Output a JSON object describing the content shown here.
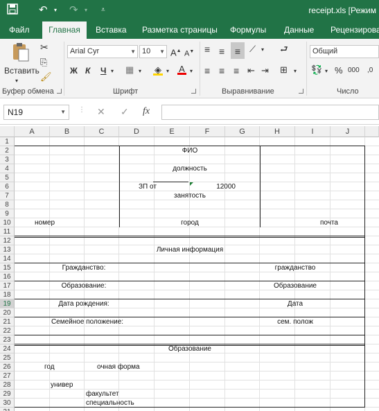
{
  "titlebar": {
    "title": "receipt.xls  [Режим"
  },
  "tabs": [
    {
      "label": "Файл",
      "active": false
    },
    {
      "label": "Главная",
      "active": true
    },
    {
      "label": "Вставка",
      "active": false
    },
    {
      "label": "Разметка страницы",
      "active": false
    },
    {
      "label": "Формулы",
      "active": false
    },
    {
      "label": "Данные",
      "active": false
    },
    {
      "label": "Рецензирова",
      "active": false
    }
  ],
  "ribbon": {
    "paste_label": "Вставить",
    "font_name": "Arial Cyr",
    "font_size": "10",
    "bold": "Ж",
    "italic": "К",
    "underline": "Ч",
    "number_format": "Общий",
    "percent": "%",
    "thousands": "000",
    "groups": {
      "clipboard": "Буфер обмена",
      "font": "Шрифт",
      "alignment": "Выравнивание",
      "number": "Число"
    }
  },
  "formula_bar": {
    "name_box": "N19",
    "fx": "fx",
    "value": ""
  },
  "columns": [
    "A",
    "B",
    "C",
    "D",
    "E",
    "F",
    "G",
    "H",
    "I",
    "J"
  ],
  "rows": [
    "1",
    "2",
    "3",
    "4",
    "5",
    "6",
    "7",
    "8",
    "9",
    "10",
    "11",
    "12",
    "13",
    "14",
    "15",
    "16",
    "17",
    "18",
    "19",
    "20",
    "21",
    "22",
    "23",
    "24",
    "25",
    "26",
    "27",
    "28",
    "29",
    "30",
    "31",
    "32"
  ],
  "selected_row": "19",
  "cells": {
    "fio": "ФИО",
    "dolzhnost": "должность",
    "zp": "ЗП от",
    "zp_value": "12000",
    "zanyatost": "занятость",
    "nomer": "номер",
    "gorod": "город",
    "pochta": "почта",
    "personal": "Личная информация",
    "citizenship_label": "Гражданство:",
    "citizenship": "гражданство",
    "education_label": "Образование:",
    "education": "Образование",
    "birth_label": "Дата рождения:",
    "birth": "Дата",
    "marital_label": "Семейное положение:",
    "marital": "сем. полож",
    "education_section": "Образование",
    "year": "год",
    "study_form": "очная форма",
    "university": "универ",
    "faculty": "факультет",
    "specialty": "специальность"
  }
}
